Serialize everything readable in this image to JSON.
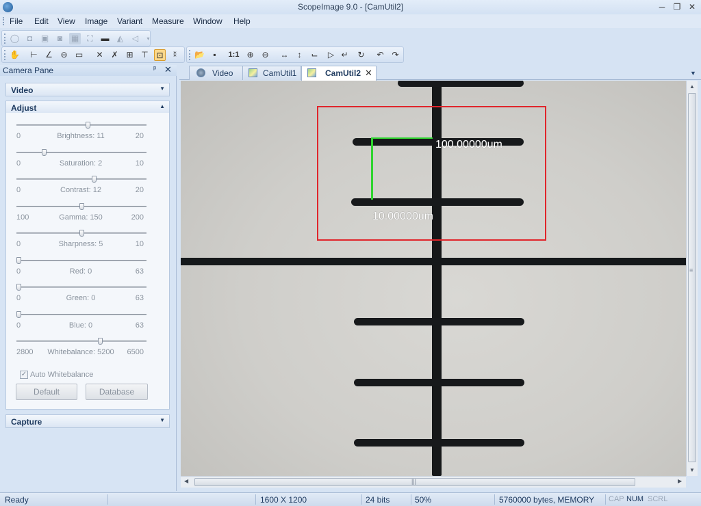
{
  "window": {
    "title": "ScopeImage 9.0 - [CamUtil2]",
    "min": "─",
    "max": "❐",
    "close": "✕"
  },
  "menu": [
    "File",
    "Edit",
    "View",
    "Image",
    "Variant",
    "Measure",
    "Window",
    "Help"
  ],
  "pane": {
    "title": "Camera Pane",
    "pin": "ᵖ",
    "close": "✕",
    "sections": {
      "video": "Video",
      "adjust": "Adjust",
      "capture": "Capture"
    },
    "sliders": [
      {
        "name": "Brightness",
        "label": "Brightness:",
        "min": "0",
        "value": "11",
        "max": "20",
        "level": 0.55
      },
      {
        "name": "Saturation",
        "label": "Saturation:",
        "min": "0",
        "value": "2",
        "max": "10",
        "level": 0.2
      },
      {
        "name": "Contrast",
        "label": "Contrast:",
        "min": "0",
        "value": "12",
        "max": "20",
        "level": 0.6
      },
      {
        "name": "Gamma",
        "label": "Gamma:",
        "min": "100",
        "value": "150",
        "max": "200",
        "level": 0.5
      },
      {
        "name": "Sharpness",
        "label": "Sharpness:",
        "min": "0",
        "value": "5",
        "max": "10",
        "level": 0.5
      },
      {
        "name": "Red",
        "label": "Red:",
        "min": "0",
        "value": "0",
        "max": "63",
        "level": 0.0
      },
      {
        "name": "Green",
        "label": "Green:",
        "min": "0",
        "value": "0",
        "max": "63",
        "level": 0.0
      },
      {
        "name": "Blue",
        "label": "Blue:",
        "min": "0",
        "value": "0",
        "max": "63",
        "level": 0.0
      },
      {
        "name": "Whitebalance",
        "label": "Whitebalance:",
        "min": "2800",
        "value": "5200",
        "max": "6500",
        "level": 0.65
      }
    ],
    "auto_whitebalance": {
      "label": "Auto Whitebalance",
      "checked": true,
      "mark": "✓"
    },
    "buttons": {
      "default": "Default",
      "database": "Database"
    },
    "chevron_down": "▼",
    "chevron_up": "▲"
  },
  "tabs": [
    {
      "label": "Video",
      "active": false
    },
    {
      "label": "CamUtil1",
      "active": false
    },
    {
      "label": "CamUtil2",
      "active": true
    }
  ],
  "tab_close": "✕",
  "tab_dropdown": "▼",
  "measurements": {
    "horizontal": "100.00000um",
    "vertical": "10.00000um"
  },
  "colors": {
    "roi": "#e0252b",
    "measure": "#2fd42f"
  },
  "scroll": {
    "up": "▲",
    "down": "▼",
    "left": "◀",
    "right": "▶",
    "grip": "≡",
    "hgrip": "|||"
  },
  "status": {
    "state": "Ready",
    "resolution": "1600 X 1200",
    "bits": "24 bits",
    "zoom": "50%",
    "memory": "5760000 bytes, MEMORY",
    "cap": "CAP",
    "num": "NUM",
    "scrl": "SCRL"
  },
  "toolbar_icons": {
    "row1": [
      "play-icon",
      "snapshot-icon",
      "record-icon",
      "camera-settings-icon",
      "grid-icon",
      "fullscreen-icon",
      "monitor-icon",
      "triangle-icon",
      "arrow-left-icon"
    ],
    "row2": [
      "hand-icon",
      "line-icon",
      "angle-icon",
      "circle-icon",
      "rectangle-icon",
      "delete-icon",
      "delete-all-icon",
      "text-icon",
      "ruler-icon",
      "calibrate-icon",
      "counter-icon"
    ],
    "row2b": [
      "open-icon",
      "save-icon",
      "actual-size-icon",
      "zoom-in-icon",
      "zoom-out-icon",
      "flip-horizontal-icon",
      "flip-vertical-icon",
      "crop-icon",
      "rotate-right-icon",
      "rotate-left-icon",
      "refresh-icon",
      "undo-icon",
      "redo-icon"
    ]
  }
}
